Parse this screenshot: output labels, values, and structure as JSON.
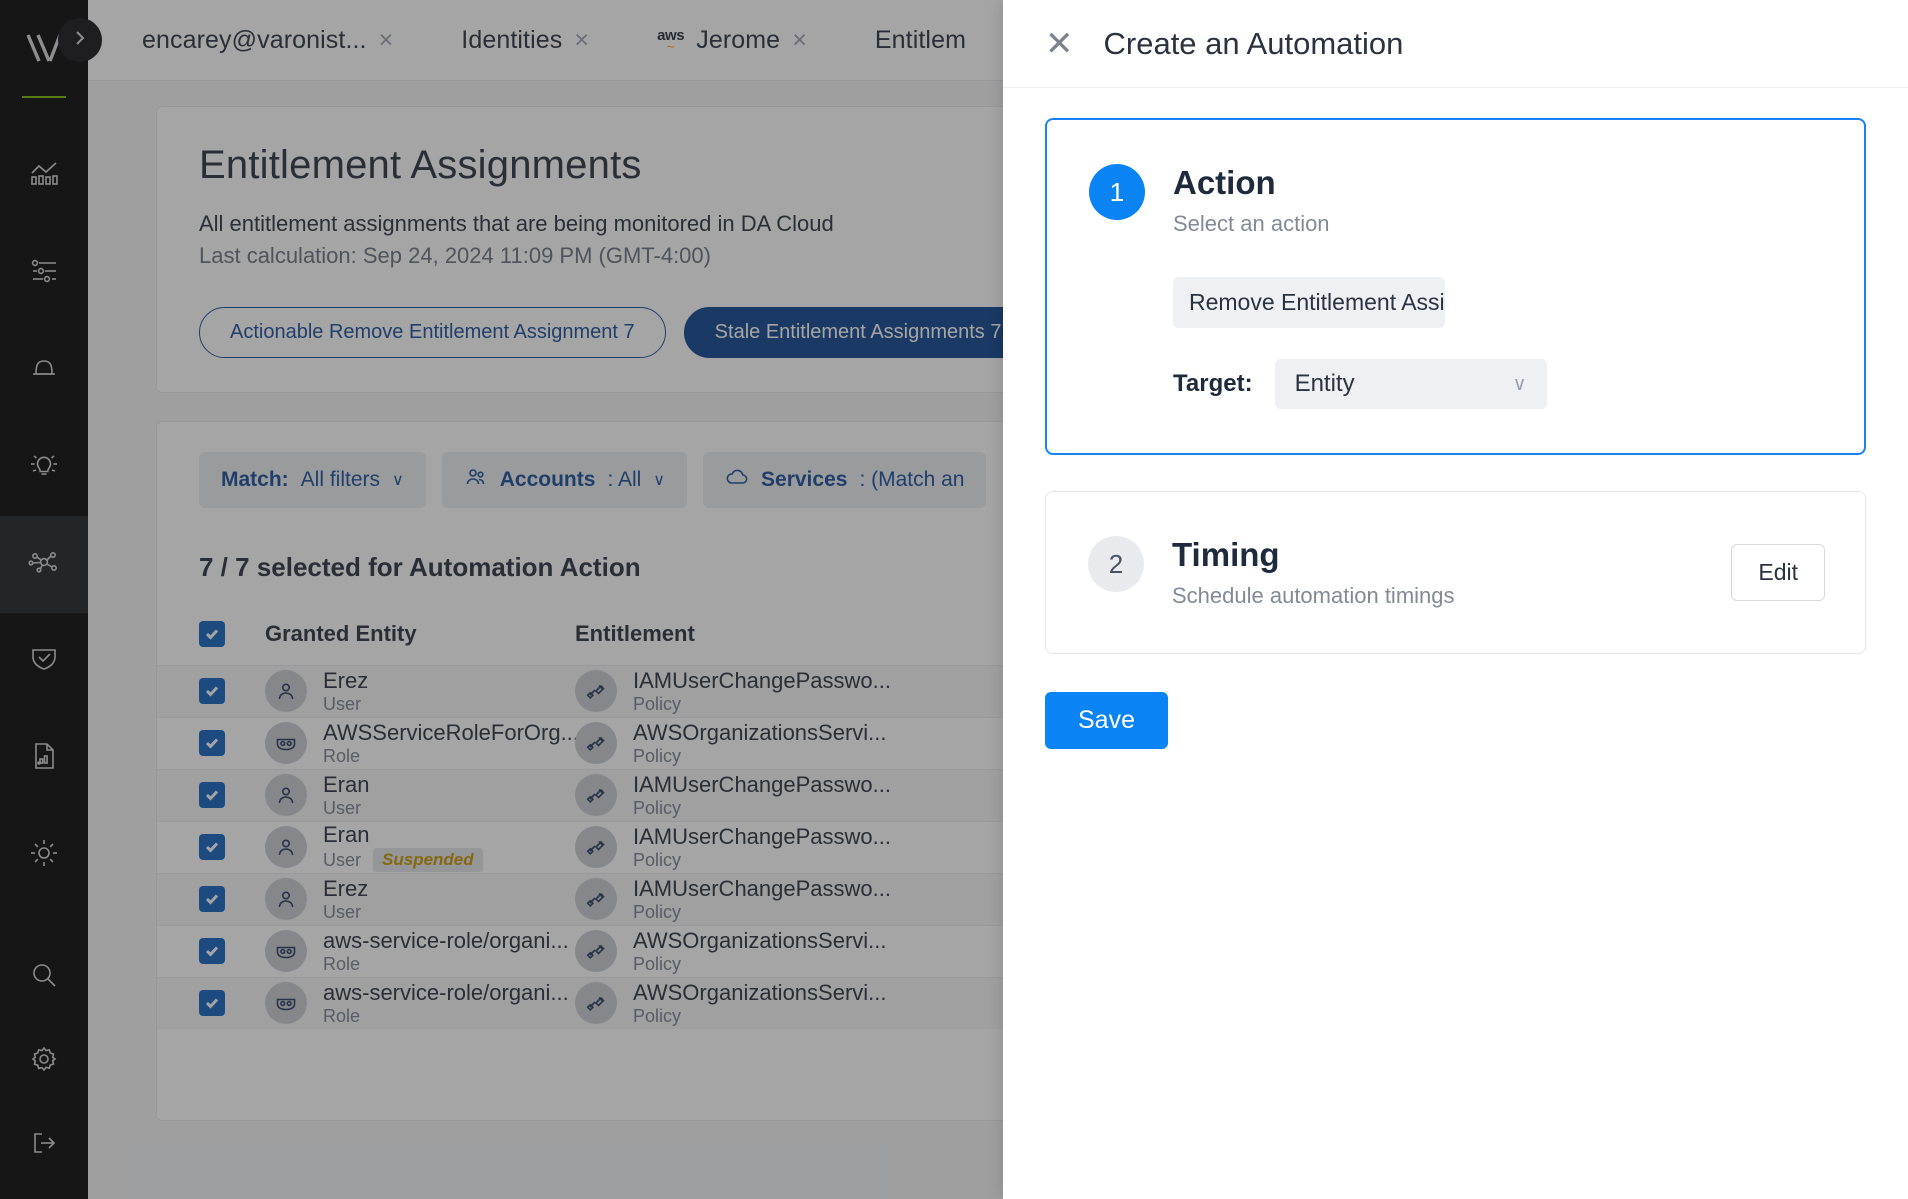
{
  "app": {
    "logo_name": "varonis-logo"
  },
  "sidebar": {
    "expand_label": "expand-sidebar",
    "items": [
      {
        "name": "insights",
        "icon": "chart-bars-icon"
      },
      {
        "name": "policies",
        "icon": "sliders-icon"
      },
      {
        "name": "alerts",
        "icon": "bell-icon"
      },
      {
        "name": "recommendations",
        "icon": "lightbulb-icon"
      },
      {
        "name": "identities",
        "icon": "network-graph-icon",
        "active": true
      },
      {
        "name": "security",
        "icon": "shield-check-icon"
      },
      {
        "name": "reports",
        "icon": "report-document-icon"
      },
      {
        "name": "theme",
        "icon": "sun-icon"
      }
    ],
    "bottom_items": [
      {
        "name": "search",
        "icon": "search-icon"
      },
      {
        "name": "settings",
        "icon": "gear-icon"
      },
      {
        "name": "logout",
        "icon": "logout-icon"
      }
    ]
  },
  "tabs": [
    {
      "label": "encarey@varonist...",
      "icon": null,
      "close": "×"
    },
    {
      "label": "Identities",
      "icon": null,
      "close": "×"
    },
    {
      "label": "Jerome",
      "icon": "aws-logo",
      "aws_text": "aws",
      "close": "×"
    },
    {
      "label": "Entitlem",
      "icon": null,
      "close": ""
    }
  ],
  "main": {
    "title": "Entitlement Assignments",
    "subtitle": "All entitlement assignments that are being monitored in DA Cloud",
    "last_calculation": "Last calculation: Sep 24, 2024 11:09 PM (GMT-4:00)",
    "pills": [
      {
        "label": "Actionable Remove Entitlement Assignment 7",
        "style": "outline"
      },
      {
        "label": "Stale Entitlement Assignments 7",
        "style": "solid"
      }
    ],
    "filters": [
      {
        "label_bold": "Match:",
        "label_rest": " All filters",
        "icon": null,
        "chevron": "∨"
      },
      {
        "label_bold": "Accounts",
        "label_rest": ": All",
        "icon": "people-icon",
        "chevron": "∨"
      },
      {
        "label_bold": "Services",
        "label_rest": ": (Match an",
        "icon": "cloud-icon",
        "chevron": ""
      }
    ],
    "selection_text": "7 / 7 selected for Automation Action",
    "table": {
      "headers": [
        "Granted Entity",
        "Entitlement"
      ],
      "rows": [
        {
          "entity": "Erez",
          "entity_type": "User",
          "entity_icon": "user-icon",
          "badge": "",
          "entitlement": "IAMUserChangePasswo...",
          "entitlement_type": "Policy",
          "checked": true
        },
        {
          "entity": "AWSServiceRoleForOrg...",
          "entity_type": "Role",
          "entity_icon": "role-mask-icon",
          "badge": "",
          "entitlement": "AWSOrganizationsServi...",
          "entitlement_type": "Policy",
          "checked": true
        },
        {
          "entity": "Eran",
          "entity_type": "User",
          "entity_icon": "user-icon",
          "badge": "",
          "entitlement": "IAMUserChangePasswo...",
          "entitlement_type": "Policy",
          "checked": true
        },
        {
          "entity": "Eran",
          "entity_type": "User",
          "entity_icon": "user-icon",
          "badge": "Suspended",
          "entitlement": "IAMUserChangePasswo...",
          "entitlement_type": "Policy",
          "checked": true
        },
        {
          "entity": "Erez",
          "entity_type": "User",
          "entity_icon": "user-icon",
          "badge": "",
          "entitlement": "IAMUserChangePasswo...",
          "entitlement_type": "Policy",
          "checked": true
        },
        {
          "entity": "aws-service-role/organi...",
          "entity_type": "Role",
          "entity_icon": "role-mask-icon",
          "badge": "",
          "entitlement": "AWSOrganizationsServi...",
          "entitlement_type": "Policy",
          "checked": true
        },
        {
          "entity": "aws-service-role/organi...",
          "entity_type": "Role",
          "entity_icon": "role-mask-icon",
          "badge": "",
          "entitlement": "AWSOrganizationsServi...",
          "entitlement_type": "Policy",
          "checked": true
        }
      ]
    }
  },
  "drawer": {
    "title": "Create an Automation",
    "close_glyph": "✕",
    "steps": [
      {
        "number": "1",
        "title": "Action",
        "subtitle": "Select an action",
        "action_chip": "Remove Entitlement Assignment",
        "target_label": "Target:",
        "target_value": "Entity",
        "target_chevron": "∨"
      },
      {
        "number": "2",
        "title": "Timing",
        "subtitle": "Schedule automation timings",
        "edit_label": "Edit"
      }
    ],
    "save_label": "Save"
  },
  "colors": {
    "accent_blue": "#0a84f5",
    "brand_green": "#7ab800",
    "pill_solid": "#10458f",
    "pill_outline_text": "#1d4f9c",
    "suspended": "#c99700",
    "rail_bg": "#0a0a0a"
  }
}
